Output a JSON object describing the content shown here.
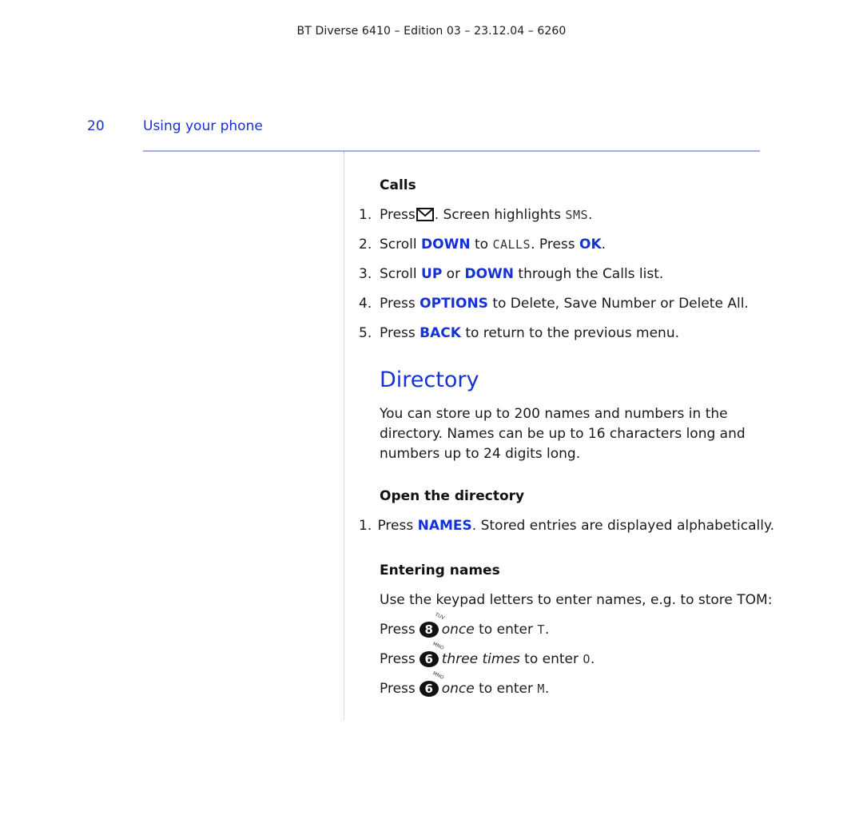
{
  "document": {
    "header": "BT Diverse 6410 – Edition 03 – 23.12.04 – 6260",
    "page_number": "20",
    "section_title": "Using your phone"
  },
  "calls": {
    "heading": "Calls",
    "steps": [
      {
        "num": "1.",
        "a": "Press",
        "icon": "envelope-icon",
        "b": ". Screen highlights ",
        "lcd": "SMS",
        "c": "."
      },
      {
        "num": "2.",
        "a": "Scroll ",
        "kw1": "DOWN",
        "b": " to ",
        "lcd": "CALLS",
        "c": ". Press ",
        "kw2": "OK",
        "d": "."
      },
      {
        "num": "3.",
        "a": "Scroll ",
        "kw1": "UP",
        "b": " or ",
        "kw2": "DOWN",
        "c": " through the Calls list."
      },
      {
        "num": "4.",
        "a": "Press ",
        "kw1": "OPTIONS",
        "b": " to Delete, Save Number or Delete All."
      },
      {
        "num": "5.",
        "a": "Press ",
        "kw1": "BACK",
        "b": " to return to the previous menu."
      }
    ]
  },
  "directory": {
    "title": "Directory",
    "intro": "You can store up to 200 names and numbers in the directory. Names can be up to 16 characters long and numbers up to 24 digits long.",
    "open": {
      "heading": "Open the directory",
      "step": {
        "num": "1.",
        "a": "Press ",
        "kw1": "NAMES",
        "b": ". Stored entries are displayed alphabetically."
      }
    },
    "entering": {
      "heading": "Entering names",
      "intro": "Use the keypad letters to enter names, e.g. to store TOM:",
      "lines": [
        {
          "a": "Press",
          "key": "8",
          "key_letters": "TUV",
          "em": "once",
          "b": " to enter ",
          "lcd": "T",
          "c": "."
        },
        {
          "a": "Press",
          "key": "6",
          "key_letters": "MNO",
          "em": "three times",
          "b": " to enter ",
          "lcd": "O",
          "c": "."
        },
        {
          "a": "Press",
          "key": "6",
          "key_letters": "MNO",
          "em": "once",
          "b": " to enter ",
          "lcd": "M",
          "c": "."
        }
      ]
    }
  },
  "colors": {
    "accent": "#1432d6",
    "rule": "#a9a9f0"
  }
}
